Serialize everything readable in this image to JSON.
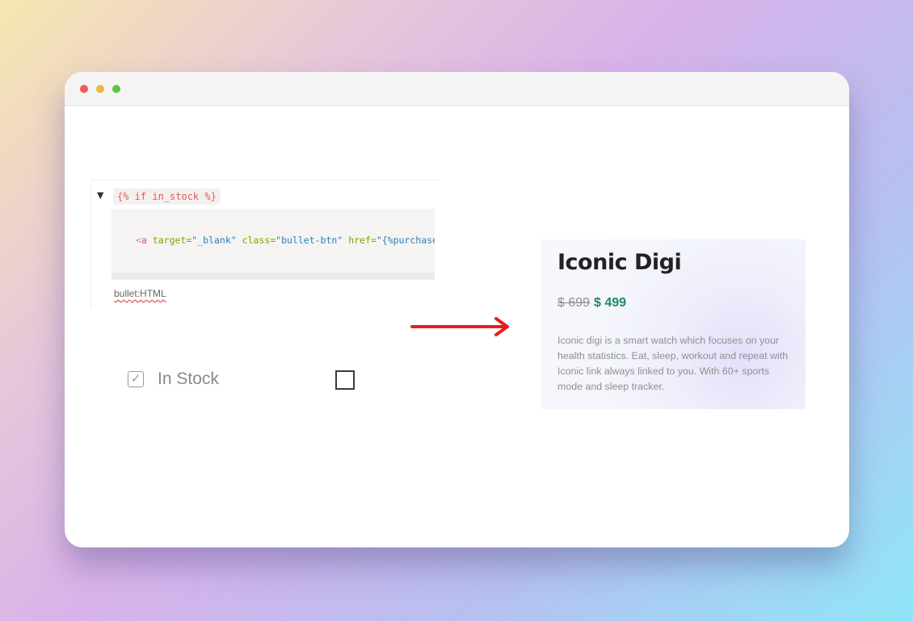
{
  "window": {
    "controls": [
      "close",
      "minimize",
      "maximize"
    ]
  },
  "editor": {
    "toggle_code": "{% if in_stock %}",
    "code_line": {
      "open": "<",
      "tag": "a",
      "attr1": "target=",
      "val1": "\"_blank\"",
      "attr2": "class=",
      "val2": "\"bullet-btn\"",
      "attr3": "href=",
      "val3": "\"{%purchase"
    },
    "caption": "bullet:HTML"
  },
  "fields": {
    "in_stock_label": "In Stock"
  },
  "arrow_color": "#ee1c1c",
  "product": {
    "name": "Iconic Digi",
    "old_price": "$ 699",
    "new_price": "$ 499",
    "description": "Iconic digi is a smart watch which focuses on your health statistics. Eat, sleep, workout and repeat with Iconic link always linked to you. With 60+ sports mode and sleep tracker."
  }
}
